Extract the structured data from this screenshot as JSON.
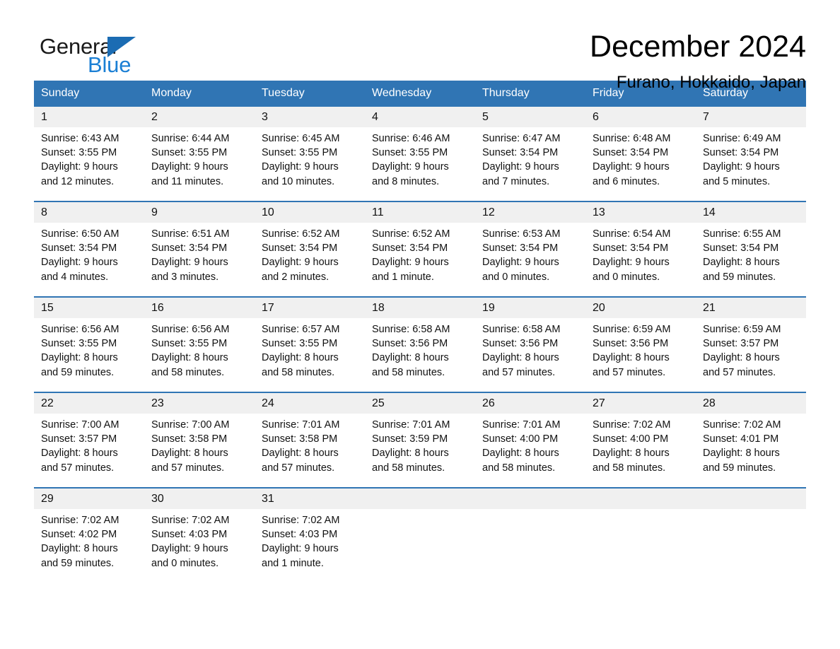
{
  "brand": {
    "name_part1": "General",
    "name_part2": "Blue",
    "logo_icon": "triangle-icon",
    "accent_color": "#1b7fd4",
    "header_color": "#3075b4"
  },
  "header": {
    "title": "December 2024",
    "subtitle": "Furano, Hokkaido, Japan"
  },
  "calendar": {
    "weekday_headers": [
      "Sunday",
      "Monday",
      "Tuesday",
      "Wednesday",
      "Thursday",
      "Friday",
      "Saturday"
    ],
    "weeks": [
      [
        {
          "day": "1",
          "sunrise": "Sunrise: 6:43 AM",
          "sunset": "Sunset: 3:55 PM",
          "daylight_line1": "Daylight: 9 hours",
          "daylight_line2": "and 12 minutes."
        },
        {
          "day": "2",
          "sunrise": "Sunrise: 6:44 AM",
          "sunset": "Sunset: 3:55 PM",
          "daylight_line1": "Daylight: 9 hours",
          "daylight_line2": "and 11 minutes."
        },
        {
          "day": "3",
          "sunrise": "Sunrise: 6:45 AM",
          "sunset": "Sunset: 3:55 PM",
          "daylight_line1": "Daylight: 9 hours",
          "daylight_line2": "and 10 minutes."
        },
        {
          "day": "4",
          "sunrise": "Sunrise: 6:46 AM",
          "sunset": "Sunset: 3:55 PM",
          "daylight_line1": "Daylight: 9 hours",
          "daylight_line2": "and 8 minutes."
        },
        {
          "day": "5",
          "sunrise": "Sunrise: 6:47 AM",
          "sunset": "Sunset: 3:54 PM",
          "daylight_line1": "Daylight: 9 hours",
          "daylight_line2": "and 7 minutes."
        },
        {
          "day": "6",
          "sunrise": "Sunrise: 6:48 AM",
          "sunset": "Sunset: 3:54 PM",
          "daylight_line1": "Daylight: 9 hours",
          "daylight_line2": "and 6 minutes."
        },
        {
          "day": "7",
          "sunrise": "Sunrise: 6:49 AM",
          "sunset": "Sunset: 3:54 PM",
          "daylight_line1": "Daylight: 9 hours",
          "daylight_line2": "and 5 minutes."
        }
      ],
      [
        {
          "day": "8",
          "sunrise": "Sunrise: 6:50 AM",
          "sunset": "Sunset: 3:54 PM",
          "daylight_line1": "Daylight: 9 hours",
          "daylight_line2": "and 4 minutes."
        },
        {
          "day": "9",
          "sunrise": "Sunrise: 6:51 AM",
          "sunset": "Sunset: 3:54 PM",
          "daylight_line1": "Daylight: 9 hours",
          "daylight_line2": "and 3 minutes."
        },
        {
          "day": "10",
          "sunrise": "Sunrise: 6:52 AM",
          "sunset": "Sunset: 3:54 PM",
          "daylight_line1": "Daylight: 9 hours",
          "daylight_line2": "and 2 minutes."
        },
        {
          "day": "11",
          "sunrise": "Sunrise: 6:52 AM",
          "sunset": "Sunset: 3:54 PM",
          "daylight_line1": "Daylight: 9 hours",
          "daylight_line2": "and 1 minute."
        },
        {
          "day": "12",
          "sunrise": "Sunrise: 6:53 AM",
          "sunset": "Sunset: 3:54 PM",
          "daylight_line1": "Daylight: 9 hours",
          "daylight_line2": "and 0 minutes."
        },
        {
          "day": "13",
          "sunrise": "Sunrise: 6:54 AM",
          "sunset": "Sunset: 3:54 PM",
          "daylight_line1": "Daylight: 9 hours",
          "daylight_line2": "and 0 minutes."
        },
        {
          "day": "14",
          "sunrise": "Sunrise: 6:55 AM",
          "sunset": "Sunset: 3:54 PM",
          "daylight_line1": "Daylight: 8 hours",
          "daylight_line2": "and 59 minutes."
        }
      ],
      [
        {
          "day": "15",
          "sunrise": "Sunrise: 6:56 AM",
          "sunset": "Sunset: 3:55 PM",
          "daylight_line1": "Daylight: 8 hours",
          "daylight_line2": "and 59 minutes."
        },
        {
          "day": "16",
          "sunrise": "Sunrise: 6:56 AM",
          "sunset": "Sunset: 3:55 PM",
          "daylight_line1": "Daylight: 8 hours",
          "daylight_line2": "and 58 minutes."
        },
        {
          "day": "17",
          "sunrise": "Sunrise: 6:57 AM",
          "sunset": "Sunset: 3:55 PM",
          "daylight_line1": "Daylight: 8 hours",
          "daylight_line2": "and 58 minutes."
        },
        {
          "day": "18",
          "sunrise": "Sunrise: 6:58 AM",
          "sunset": "Sunset: 3:56 PM",
          "daylight_line1": "Daylight: 8 hours",
          "daylight_line2": "and 58 minutes."
        },
        {
          "day": "19",
          "sunrise": "Sunrise: 6:58 AM",
          "sunset": "Sunset: 3:56 PM",
          "daylight_line1": "Daylight: 8 hours",
          "daylight_line2": "and 57 minutes."
        },
        {
          "day": "20",
          "sunrise": "Sunrise: 6:59 AM",
          "sunset": "Sunset: 3:56 PM",
          "daylight_line1": "Daylight: 8 hours",
          "daylight_line2": "and 57 minutes."
        },
        {
          "day": "21",
          "sunrise": "Sunrise: 6:59 AM",
          "sunset": "Sunset: 3:57 PM",
          "daylight_line1": "Daylight: 8 hours",
          "daylight_line2": "and 57 minutes."
        }
      ],
      [
        {
          "day": "22",
          "sunrise": "Sunrise: 7:00 AM",
          "sunset": "Sunset: 3:57 PM",
          "daylight_line1": "Daylight: 8 hours",
          "daylight_line2": "and 57 minutes."
        },
        {
          "day": "23",
          "sunrise": "Sunrise: 7:00 AM",
          "sunset": "Sunset: 3:58 PM",
          "daylight_line1": "Daylight: 8 hours",
          "daylight_line2": "and 57 minutes."
        },
        {
          "day": "24",
          "sunrise": "Sunrise: 7:01 AM",
          "sunset": "Sunset: 3:58 PM",
          "daylight_line1": "Daylight: 8 hours",
          "daylight_line2": "and 57 minutes."
        },
        {
          "day": "25",
          "sunrise": "Sunrise: 7:01 AM",
          "sunset": "Sunset: 3:59 PM",
          "daylight_line1": "Daylight: 8 hours",
          "daylight_line2": "and 58 minutes."
        },
        {
          "day": "26",
          "sunrise": "Sunrise: 7:01 AM",
          "sunset": "Sunset: 4:00 PM",
          "daylight_line1": "Daylight: 8 hours",
          "daylight_line2": "and 58 minutes."
        },
        {
          "day": "27",
          "sunrise": "Sunrise: 7:02 AM",
          "sunset": "Sunset: 4:00 PM",
          "daylight_line1": "Daylight: 8 hours",
          "daylight_line2": "and 58 minutes."
        },
        {
          "day": "28",
          "sunrise": "Sunrise: 7:02 AM",
          "sunset": "Sunset: 4:01 PM",
          "daylight_line1": "Daylight: 8 hours",
          "daylight_line2": "and 59 minutes."
        }
      ],
      [
        {
          "day": "29",
          "sunrise": "Sunrise: 7:02 AM",
          "sunset": "Sunset: 4:02 PM",
          "daylight_line1": "Daylight: 8 hours",
          "daylight_line2": "and 59 minutes."
        },
        {
          "day": "30",
          "sunrise": "Sunrise: 7:02 AM",
          "sunset": "Sunset: 4:03 PM",
          "daylight_line1": "Daylight: 9 hours",
          "daylight_line2": "and 0 minutes."
        },
        {
          "day": "31",
          "sunrise": "Sunrise: 7:02 AM",
          "sunset": "Sunset: 4:03 PM",
          "daylight_line1": "Daylight: 9 hours",
          "daylight_line2": "and 1 minute."
        },
        {
          "day": "",
          "sunrise": "",
          "sunset": "",
          "daylight_line1": "",
          "daylight_line2": ""
        },
        {
          "day": "",
          "sunrise": "",
          "sunset": "",
          "daylight_line1": "",
          "daylight_line2": ""
        },
        {
          "day": "",
          "sunrise": "",
          "sunset": "",
          "daylight_line1": "",
          "daylight_line2": ""
        },
        {
          "day": "",
          "sunrise": "",
          "sunset": "",
          "daylight_line1": "",
          "daylight_line2": ""
        }
      ]
    ]
  }
}
